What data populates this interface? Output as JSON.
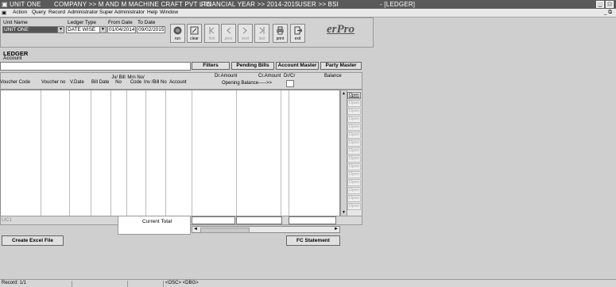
{
  "titlebar": {
    "unit": "UNIT ONE",
    "company": "COMPANY >> M AND M MACHINE CRAFT PVT LTD",
    "year": "FINANCIAL YEAR >> 2014-2015",
    "user": "USER >> BSI",
    "window": "- [LEDGER]"
  },
  "menu": [
    "Action",
    "Query",
    "Record",
    "Administrator",
    "Super Administrator",
    "Help",
    "Window"
  ],
  "filters": {
    "unit_name_label": "Unit Name",
    "unit_name_value": "UNIT ONE",
    "ledger_type_label": "Ledger Type",
    "ledger_type_value": "DATE WISE",
    "from_date_label": "From Date",
    "from_date_value": "01/04/2014",
    "to_date_label": "To Date",
    "to_date_value": "09/02/2015"
  },
  "toolbar": {
    "run": "run",
    "clear": "clear",
    "first": "first",
    "prev": "prev",
    "next": "next",
    "last": "last",
    "print": "print",
    "exit": "exit"
  },
  "logo": "erPro",
  "ledger": {
    "title": "LEDGER",
    "account_label": "Account",
    "filters_btn": "Filters",
    "pending_bills_btn": "Pending Bills",
    "account_master_btn": "Account Master",
    "party_master_btn": "Party Master",
    "dr_amount": "Dr.Amount",
    "cr_amount": "Cr.Amount",
    "drcr": "Dr/Cr",
    "balance": "Balance",
    "opening_balance": "Opening Balance----->>",
    "columns": [
      "Voucher Code",
      "Voucher no",
      "V.Date",
      "Bill Date",
      "Jv/ Bill No",
      "Mrn No/ Code",
      "Inv /Bill No",
      "Account"
    ],
    "open_btn": "Open",
    "uc_label": "UC1",
    "current_total": "Current Total",
    "create_excel": "Create Excel File",
    "fc_statement": "FC Statement"
  },
  "status": {
    "record": "Record: 1/1",
    "dsc": "<OSC> <DBG>"
  }
}
